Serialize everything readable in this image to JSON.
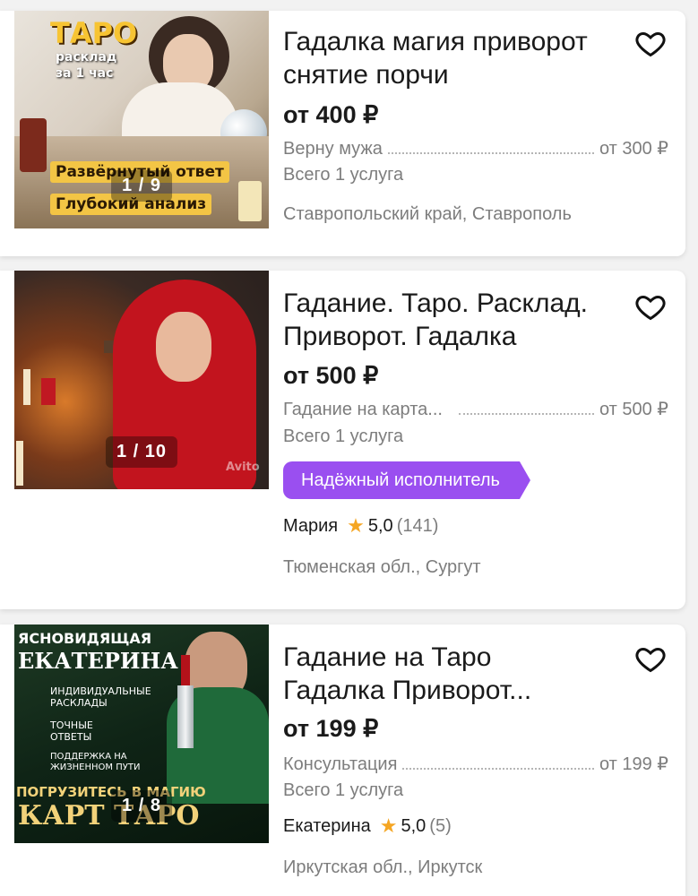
{
  "listings": [
    {
      "title": "Гадалка магия приворот снятие порчи",
      "price": "от 400 ₽",
      "service_name": "Верну мужа",
      "service_price": "от 300 ₽",
      "services_total": "Всего 1 услуга",
      "location": "Ставропольский край, Ставрополь",
      "photo_counter": "1 / 9",
      "image_text": {
        "headline": "ТАРО",
        "sub1": "расклад",
        "sub2": "за 1 час",
        "banner1": "Развёрнутый ответ",
        "banner2": "Глубокий анализ"
      }
    },
    {
      "title": "Гадание. Таро. Расклад. Приворот. Гадалка",
      "price": "от 500 ₽",
      "service_name": "Гадание на карта...",
      "service_price": "от 500 ₽",
      "services_total": "Всего 1 услуга",
      "badge": "Надёжный исполнитель",
      "seller_name": "Мария",
      "rating": "5,0",
      "reviews": "(141)",
      "location": "Тюменская обл., Сургут",
      "photo_counter": "1 / 10",
      "image_text": {
        "watermark": "Avito"
      }
    },
    {
      "title": "Гадание на Таро Гадалка Приворот...",
      "price": "от 199 ₽",
      "service_name": "Консультация",
      "service_price": "от 199 ₽",
      "services_total": "Всего 1 услуга",
      "seller_name": "Екатерина",
      "rating": "5,0",
      "reviews": "(5)",
      "location": "Иркутская обл., Иркутск",
      "photo_counter": "1 / 8",
      "image_text": {
        "top": "ЯСНОВИДЯЩАЯ",
        "name": "ЕКАТЕРИНА",
        "f1": "ИНДИВИДУАЛЬНЫЕ РАСКЛАДЫ",
        "f2": "ТОЧНЫЕ ОТВЕТЫ",
        "f3": "ПОДДЕРЖКА НА ЖИЗНЕННОМ ПУТИ",
        "cta1": "ПОГРУЗИТЕСЬ В МАГИЮ",
        "cta2": "КАРТ ТАРО"
      }
    }
  ],
  "colors": {
    "badge": "#9a4ff0",
    "star": "#f5a623",
    "muted": "#7d7d7d"
  }
}
